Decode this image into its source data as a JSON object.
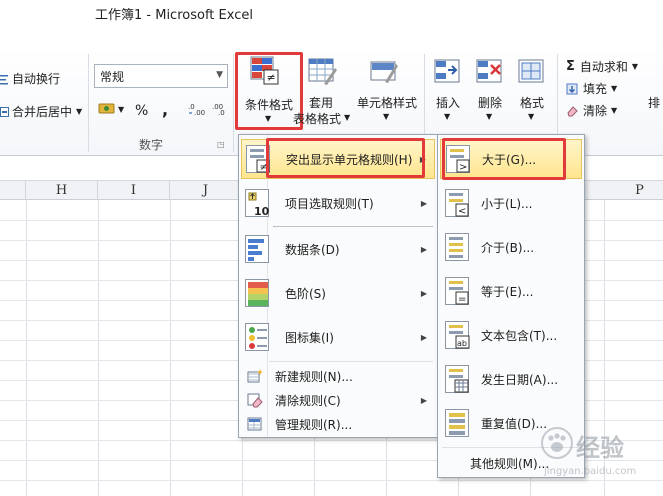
{
  "window": {
    "title": "工作簿1  -  Microsoft Excel"
  },
  "ribbon": {
    "wrap_text": "自动换行",
    "merge_center": "合并后居中",
    "number_format_value": "常规",
    "percent_symbol": "%",
    "comma_symbol": ",",
    "number_group_label": "数字",
    "conditional_formatting": "条件格式",
    "format_as_table_line1": "套用",
    "format_as_table_line2": "表格格式",
    "cell_styles": "单元格样式",
    "insert": "插入",
    "delete": "删除",
    "format": "格式",
    "autosum": "自动求和",
    "fill": "填充",
    "clear": "清除",
    "sort_partial": "排",
    "sigma_symbol": "Σ"
  },
  "columns": [
    "H",
    "I",
    "J",
    "P"
  ],
  "cf_menu": {
    "items": [
      {
        "label": "突出显示单元格规则(H)"
      },
      {
        "label": "项目选取规则(T)"
      },
      {
        "label": "数据条(D)"
      },
      {
        "label": "色阶(S)"
      },
      {
        "label": "图标集(I)"
      }
    ],
    "actions": [
      {
        "label": "新建规则(N)..."
      },
      {
        "label": "清除规则(C)"
      },
      {
        "label": "管理规则(R)..."
      }
    ]
  },
  "highlight_submenu": {
    "items": [
      {
        "label": "大于(G)..."
      },
      {
        "label": "小于(L)..."
      },
      {
        "label": "介于(B)..."
      },
      {
        "label": "等于(E)..."
      },
      {
        "label": "文本包含(T)..."
      },
      {
        "label": "发生日期(A)..."
      },
      {
        "label": "重复值(D)..."
      }
    ],
    "more_rules": "其他规则(M)..."
  },
  "watermark": {
    "text": "经验",
    "site": "jingyan.baidu.com"
  },
  "colors": {
    "highlight_top": "#fff5c9",
    "highlight_bottom": "#ffe58e",
    "annotation_red": "#e23a3a",
    "menu_bg": "#fafbfc",
    "ribbon_border": "#c6ccd4"
  }
}
